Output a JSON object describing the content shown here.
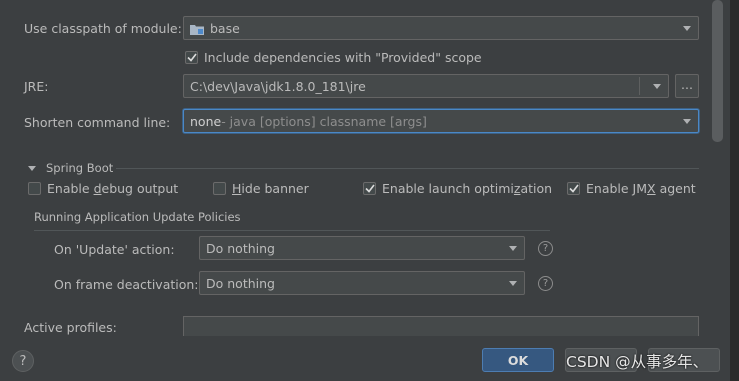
{
  "module": {
    "label": "Use classpath of module:",
    "value": "base",
    "include_deps_label": "Include dependencies with \"Provided\" scope",
    "include_deps_checked": true
  },
  "jre": {
    "label": "JRE:",
    "value": "C:\\dev\\Java\\jdk1.8.0_181\\jre",
    "browse_label": "..."
  },
  "shorten": {
    "label": "Shorten command line:",
    "value_main": "none",
    "value_detail": " - java [options] classname [args]"
  },
  "spring_boot": {
    "section_title": "Spring Boot",
    "options": [
      {
        "pre": "Enable ",
        "ul": "d",
        "post": "ebug output",
        "checked": false
      },
      {
        "pre": "",
        "ul": "H",
        "post": "ide banner",
        "checked": false
      },
      {
        "pre": "Enable launch optimi",
        "ul": "z",
        "post": "ation",
        "checked": true
      },
      {
        "pre": "Enable JM",
        "ul": "X",
        "post": " agent",
        "checked": true
      }
    ],
    "policies_title": "Running Application Update Policies",
    "update_action": {
      "label": "On 'Update' action:",
      "value": "Do nothing"
    },
    "frame_deactivation": {
      "label": "On frame deactivation:",
      "value": "Do nothing"
    },
    "help_glyph": "?"
  },
  "active_profiles": {
    "label": "Active profiles:",
    "value": ""
  },
  "footer": {
    "help_glyph": "?",
    "ok_label": "OK",
    "watermark": "CSDN @从事多年、"
  },
  "colors": {
    "background": "#3c3f41",
    "ok_button": "#365880",
    "focus_border": "#4a88c7"
  }
}
